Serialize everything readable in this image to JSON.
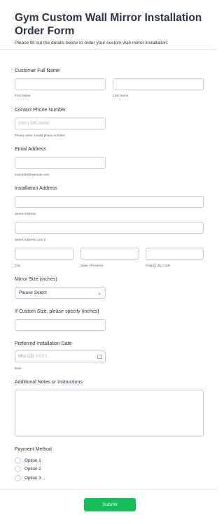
{
  "header": {
    "title": "Gym Custom Wall Mirror Installation Order Form",
    "subtitle": "Please fill out the details below to order your custom wall mirror installation."
  },
  "fields": {
    "name": {
      "label": "Customer Full Name",
      "first_sub": "First Name",
      "last_sub": "Last Name"
    },
    "phone": {
      "label": "Contact Phone Number",
      "placeholder": "(000) 000-0000",
      "sub": "Please enter a valid phone number."
    },
    "email": {
      "label": "Email Address",
      "sub": "example@example.com"
    },
    "address": {
      "label": "Installation Address",
      "street_sub": "Street Address",
      "street2_sub": "Street Address Line 2",
      "city_sub": "City",
      "state_sub": "State / Province",
      "zip_sub": "Postal / Zip Code"
    },
    "mirror_size": {
      "label": "Mirror Size (inches)",
      "selected": "Please Select"
    },
    "custom_size": {
      "label": "If Custom Size, please specify (inches)"
    },
    "date": {
      "label": "Preferred Installation Date",
      "placeholder": "MM-DD-YYYY",
      "sub": "Date"
    },
    "notes": {
      "label": "Additional Notes or Instructions"
    },
    "payment": {
      "label": "Payment Method",
      "options": [
        "Option 1",
        "Option 2",
        "Option 3"
      ]
    }
  },
  "footer": {
    "submit_label": "Submit"
  }
}
